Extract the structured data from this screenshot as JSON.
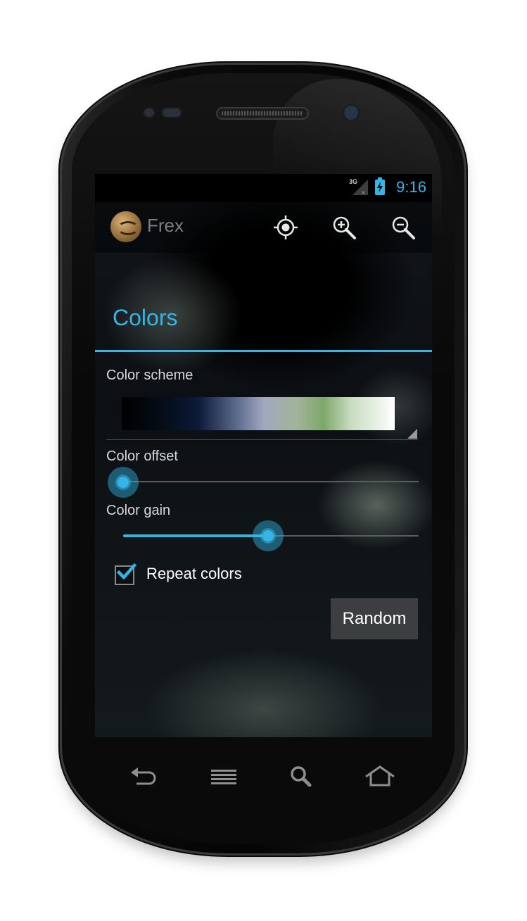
{
  "status_bar": {
    "network": "3G",
    "time": "9:16"
  },
  "action_bar": {
    "app_title": "Frex",
    "icons": [
      "crosshair-icon",
      "zoom-in-icon",
      "zoom-out-icon"
    ]
  },
  "dialog": {
    "title": "Colors",
    "color_scheme_label": "Color scheme",
    "color_offset_label": "Color offset",
    "color_offset_value": 0.0,
    "color_gain_label": "Color gain",
    "color_gain_value": 0.49,
    "repeat_colors_label": "Repeat colors",
    "repeat_colors_checked": true,
    "random_button": "Random"
  },
  "colors": {
    "accent": "#33b5e5",
    "gradient_stops": [
      "#000000",
      "#0c1a3a",
      "#a0a8c0",
      "#7ea86a",
      "#ffffff"
    ]
  },
  "nav_bar": {
    "icons": [
      "back-icon",
      "menu-icon",
      "search-icon",
      "home-icon"
    ]
  }
}
